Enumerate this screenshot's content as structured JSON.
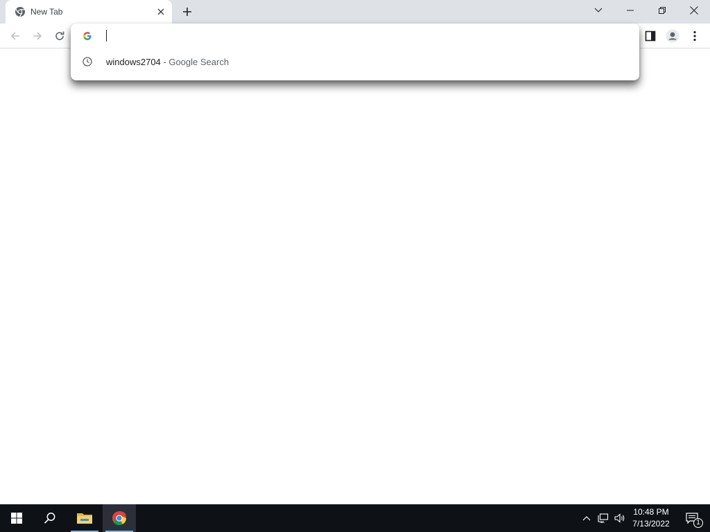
{
  "browser": {
    "tab": {
      "title": "New Tab",
      "favicon": "chrome-icon"
    },
    "window_controls": [
      "tab-search-icon",
      "minimize-icon",
      "restore-icon",
      "close-icon"
    ],
    "toolbar": {
      "buttons": [
        "back-arrow-icon",
        "forward-arrow-icon",
        "reload-icon",
        "side-panel-icon",
        "profile-icon",
        "more-menu-icon"
      ]
    },
    "omnibox": {
      "value": "",
      "search_engine_icon": "google-icon",
      "suggestions": [
        {
          "icon": "history-clock-icon",
          "query": "windows2704",
          "separator": " - ",
          "description": "Google Search"
        }
      ]
    }
  },
  "taskbar": {
    "apps": [
      "windows-start-icon",
      "search-icon",
      "file-explorer-icon",
      "chrome-icon"
    ],
    "tray": {
      "icons": [
        "chevron-up-icon",
        "network-icon",
        "volume-icon"
      ],
      "time": "10:48 PM",
      "date": "7/13/2022",
      "notification_count": "1"
    }
  },
  "colors": {
    "tabstrip_bg": "#dee1e6",
    "taskbar_bg": "#0e1217",
    "accent": "#76b9ed"
  }
}
